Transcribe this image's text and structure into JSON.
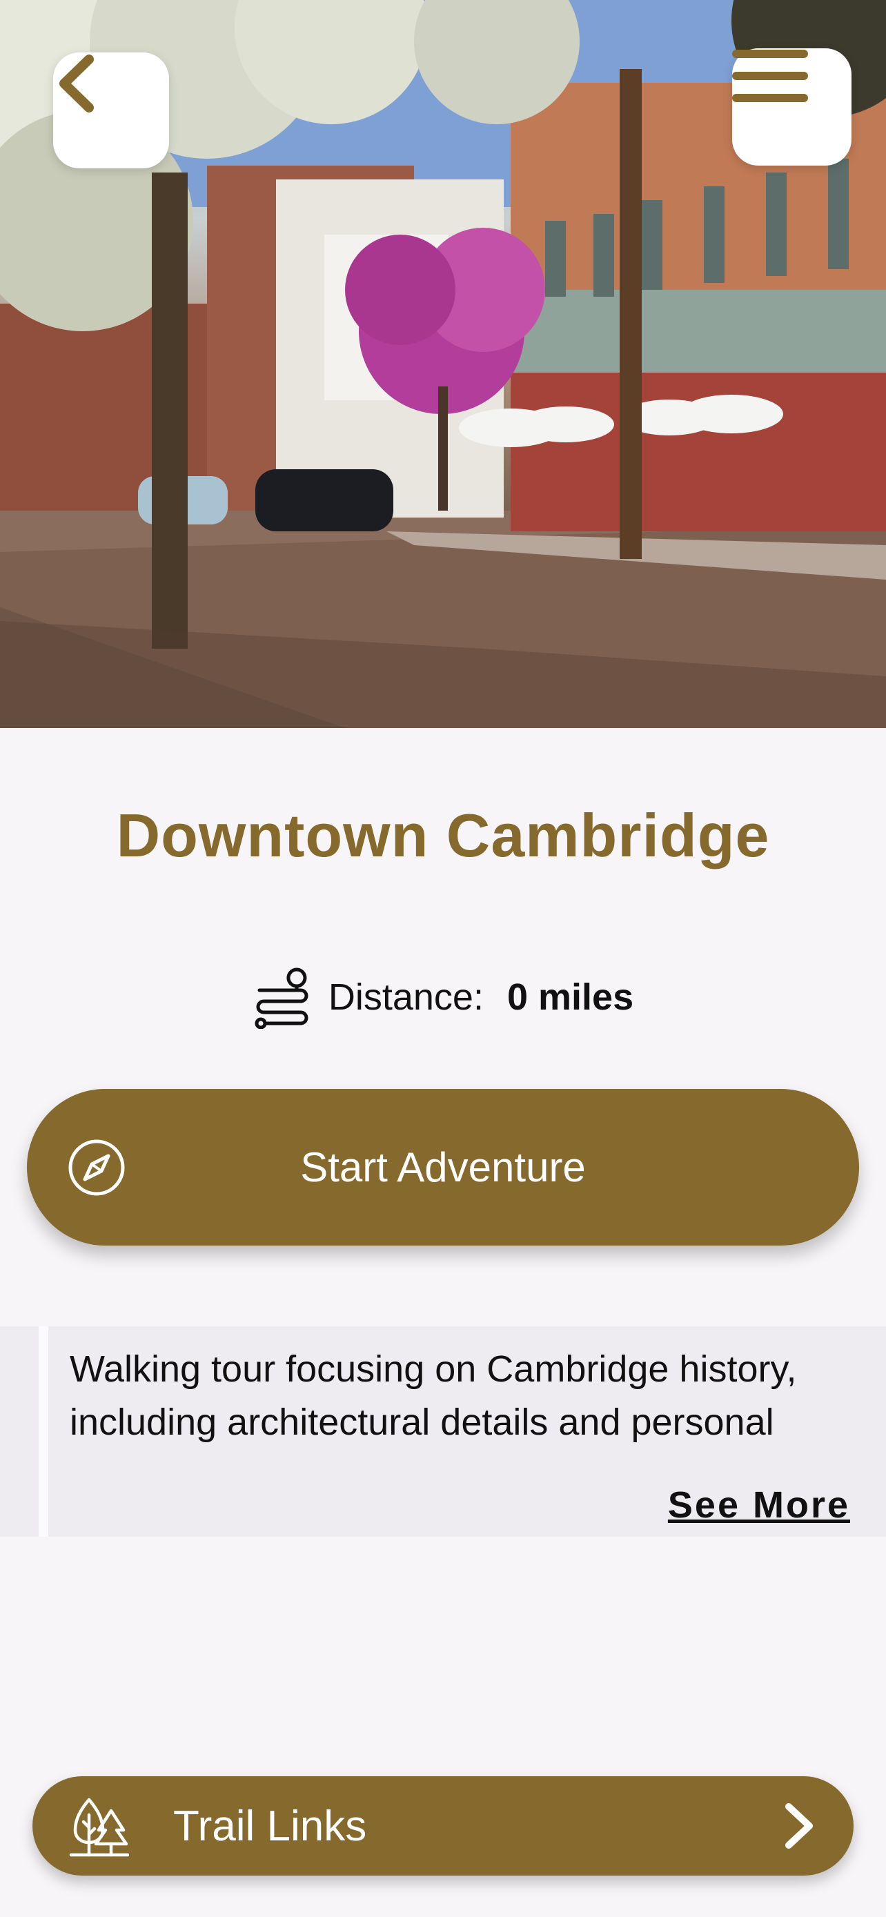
{
  "header": {
    "hero_image": "street-scene-photo",
    "back_icon": "chevron-left-icon",
    "menu_icon": "hamburger-menu-icon"
  },
  "tour": {
    "title": "Downtown Cambridge",
    "distance_label": "Distance:",
    "distance_value": "0 miles",
    "distance_icon": "route-icon"
  },
  "actions": {
    "start_label": "Start Adventure",
    "start_icon": "compass-icon"
  },
  "description": {
    "text": "Walking tour focusing on Cambridge history, including architectural details and personal",
    "see_more": "See More"
  },
  "footer": {
    "trail_links_label": "Trail Links",
    "trail_icon": "trees-icon",
    "chevron_icon": "chevron-right-icon"
  },
  "colors": {
    "brand": "#86692c",
    "background": "#f7f5f7",
    "description_bg": "#eeecf1"
  }
}
